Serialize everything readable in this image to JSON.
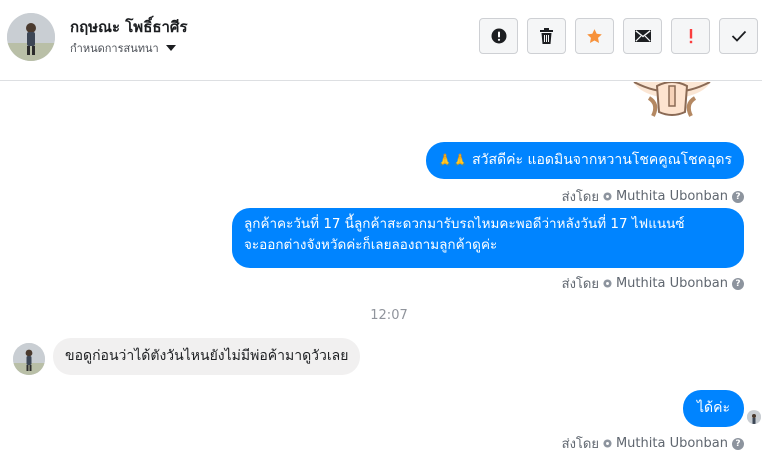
{
  "header": {
    "contact_name": "กฤษณะ โพธิ์ธาศีร",
    "subtitle": "กำหนดการสนทนา",
    "actions": [
      {
        "name": "info-icon",
        "label": "!",
        "color": "#1c1e21"
      },
      {
        "name": "trash-icon",
        "color": "#1c1e21"
      },
      {
        "name": "star-icon",
        "color": "#f7923b"
      },
      {
        "name": "envelope-icon",
        "color": "#1c1e21"
      },
      {
        "name": "important-icon",
        "label": "!",
        "color": "#fa3e3e"
      },
      {
        "name": "checkmark-icon",
        "color": "#1c1e21"
      }
    ]
  },
  "messages": [
    {
      "direction": "outgoing",
      "emoji": "🙏🙏",
      "text": "สวัสดีค่ะ แอดมินจากหวานโชคคูณโชคอุดร",
      "sent_by_label": "ส่งโดย",
      "sender": "Muthita Ubonban"
    },
    {
      "direction": "outgoing",
      "lines": [
        "ลูกค้าคะวันที่ 17 นี้ลูกค้าสะดวกมารับรถไหมคะพอดีว่าหลังวันที่ 17 ไฟแนนซ์",
        "จะออกต่างจังหวัดค่ะก็เลยลองถามลูกค้าดูค่ะ"
      ],
      "sent_by_label": "ส่งโดย",
      "sender": "Muthita Ubonban"
    },
    {
      "type": "timestamp",
      "text": "12:07"
    },
    {
      "direction": "incoming",
      "text": "ขอดูก่อนว่าได้ตังวันไหนยังไม่มีพ่อค้ามาดูวัวเลย"
    },
    {
      "direction": "outgoing",
      "text": "ได้ค่ะ",
      "sent_by_label": "ส่งโดย",
      "sender": "Muthita Ubonban"
    }
  ],
  "colors": {
    "outgoing_bubble": "#0084ff",
    "incoming_bubble": "#f1f0f0",
    "meta_text": "#606770"
  }
}
